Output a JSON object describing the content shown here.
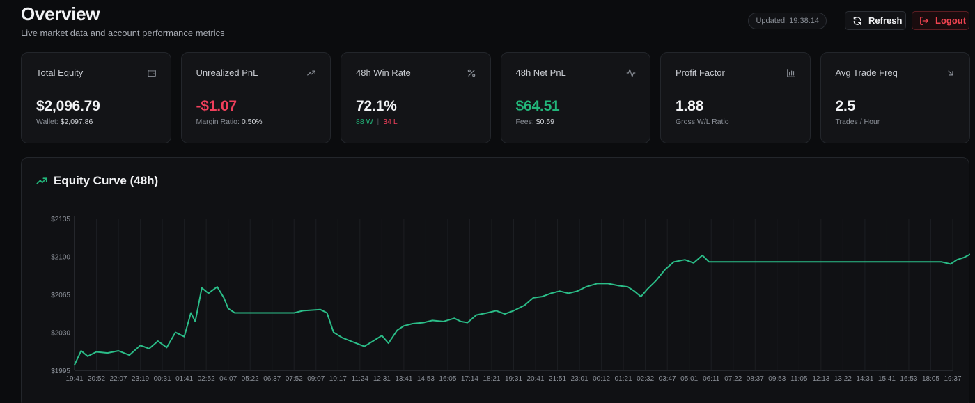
{
  "header": {
    "title": "Overview",
    "subtitle": "Live market data and account performance metrics",
    "updated": "Updated: 19:38:14",
    "refresh_label": "Refresh",
    "logout_label": "Logout"
  },
  "stats": [
    {
      "label": "Total Equity",
      "value": "$2,096.79",
      "sub_label": "Wallet:",
      "sub_value": "$2,097.86",
      "icon": "wallet-icon"
    },
    {
      "label": "Unrealized PnL",
      "value": "-$1.07",
      "sub_label": "Margin Ratio:",
      "sub_value": "0.50%",
      "icon": "trending-up-icon"
    },
    {
      "label": "48h Win Rate",
      "value": "72.1%",
      "wins": "88 W",
      "losses": "34 L",
      "sep": "|",
      "icon": "percent-icon"
    },
    {
      "label": "48h Net PnL",
      "value": "$64.51",
      "sub_label": "Fees:",
      "sub_value": "$0.59",
      "icon": "activity-icon"
    },
    {
      "label": "Profit Factor",
      "value": "1.88",
      "sub_label": "Gross W/L Ratio",
      "icon": "bar-chart-icon"
    },
    {
      "label": "Avg Trade Freq",
      "value": "2.5",
      "sub_label": "Trades / Hour",
      "icon": "arrow-down-right-icon"
    }
  ],
  "colors": {
    "positive": "#22b67a",
    "negative": "#ef3f5b",
    "line": "#2bbd88"
  },
  "chart_data": {
    "type": "line",
    "title": "Equity Curve (48h)",
    "ylim": [
      1995,
      2135
    ],
    "y_ticks": [
      "$2135",
      "$2100",
      "$2065",
      "$2030",
      "$1995"
    ],
    "y_tick_values": [
      2135,
      2100,
      2065,
      2030,
      1995
    ],
    "x_ticks": [
      "19:41",
      "20:52",
      "22:07",
      "23:19",
      "00:31",
      "01:41",
      "02:52",
      "04:07",
      "05:22",
      "06:37",
      "07:52",
      "09:07",
      "10:17",
      "11:24",
      "12:31",
      "13:41",
      "14:53",
      "16:05",
      "17:14",
      "18:21",
      "19:31",
      "20:41",
      "21:51",
      "23:01",
      "00:12",
      "01:21",
      "02:32",
      "03:47",
      "05:01",
      "06:11",
      "07:22",
      "08:37",
      "09:53",
      "11:05",
      "12:13",
      "13:22",
      "14:31",
      "15:41",
      "16:53",
      "18:05",
      "19:37"
    ],
    "grid": true,
    "series": [
      {
        "values": [
          [
            0,
            2000
          ],
          [
            0.3,
            2013
          ],
          [
            0.6,
            2008
          ],
          [
            1.0,
            2012
          ],
          [
            1.5,
            2011
          ],
          [
            2.0,
            2013
          ],
          [
            2.5,
            2009
          ],
          [
            3.0,
            2018
          ],
          [
            3.4,
            2015
          ],
          [
            3.8,
            2022
          ],
          [
            4.2,
            2016
          ],
          [
            4.6,
            2030
          ],
          [
            5.0,
            2026
          ],
          [
            5.3,
            2048
          ],
          [
            5.5,
            2040
          ],
          [
            5.8,
            2071
          ],
          [
            6.1,
            2066
          ],
          [
            6.5,
            2072
          ],
          [
            6.8,
            2062
          ],
          [
            7.0,
            2052
          ],
          [
            7.3,
            2048
          ],
          [
            9.0,
            2048
          ],
          [
            10.0,
            2048
          ],
          [
            10.4,
            2050
          ],
          [
            11.2,
            2051
          ],
          [
            11.5,
            2048
          ],
          [
            11.8,
            2030
          ],
          [
            12.2,
            2025
          ],
          [
            12.7,
            2021
          ],
          [
            13.2,
            2017
          ],
          [
            13.6,
            2022
          ],
          [
            14.0,
            2027
          ],
          [
            14.3,
            2020
          ],
          [
            14.7,
            2032
          ],
          [
            15.0,
            2036
          ],
          [
            15.4,
            2038
          ],
          [
            15.9,
            2039
          ],
          [
            16.3,
            2041
          ],
          [
            16.8,
            2040
          ],
          [
            17.3,
            2043
          ],
          [
            17.6,
            2040
          ],
          [
            17.9,
            2039
          ],
          [
            18.3,
            2046
          ],
          [
            18.8,
            2048
          ],
          [
            19.2,
            2050
          ],
          [
            19.6,
            2047
          ],
          [
            20.0,
            2050
          ],
          [
            20.5,
            2055
          ],
          [
            20.9,
            2062
          ],
          [
            21.3,
            2063
          ],
          [
            21.7,
            2066
          ],
          [
            22.1,
            2068
          ],
          [
            22.5,
            2066
          ],
          [
            22.9,
            2068
          ],
          [
            23.3,
            2072
          ],
          [
            23.8,
            2075
          ],
          [
            24.3,
            2075
          ],
          [
            24.8,
            2073
          ],
          [
            25.2,
            2072
          ],
          [
            25.5,
            2068
          ],
          [
            25.8,
            2063
          ],
          [
            26.1,
            2070
          ],
          [
            26.5,
            2078
          ],
          [
            26.9,
            2088
          ],
          [
            27.3,
            2095
          ],
          [
            27.8,
            2097
          ],
          [
            28.2,
            2094
          ],
          [
            28.6,
            2101
          ],
          [
            28.9,
            2095
          ],
          [
            29.2,
            2095
          ],
          [
            31.0,
            2095
          ],
          [
            33.0,
            2095
          ],
          [
            35.0,
            2095
          ],
          [
            37.0,
            2095
          ],
          [
            39.5,
            2095
          ],
          [
            39.9,
            2093
          ],
          [
            40.2,
            2097
          ],
          [
            40.5,
            2099
          ],
          [
            40.8,
            2102
          ],
          [
            41.1,
            2104
          ],
          [
            41.4,
            2096
          ]
        ]
      }
    ]
  }
}
